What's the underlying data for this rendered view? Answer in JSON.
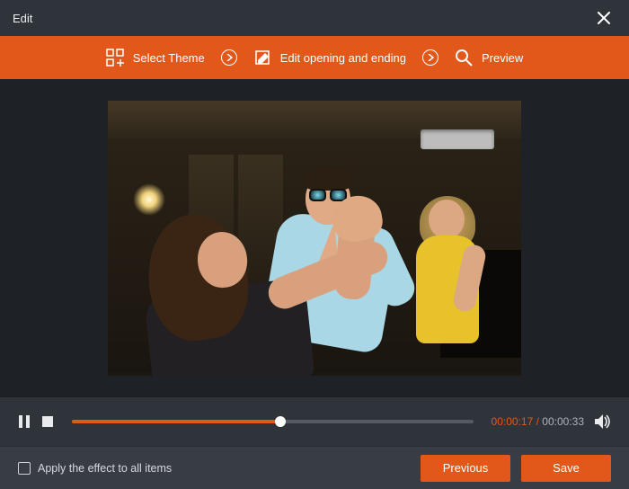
{
  "window": {
    "title": "Edit"
  },
  "toolbar": {
    "theme_label": "Select Theme",
    "edit_label": "Edit opening and ending",
    "preview_label": "Preview"
  },
  "player": {
    "current_time": "00:00:17",
    "total_time": "00:00:33",
    "progress_percent": 52
  },
  "footer": {
    "apply_all_label": "Apply the effect to all items",
    "previous_label": "Previous",
    "save_label": "Save"
  }
}
